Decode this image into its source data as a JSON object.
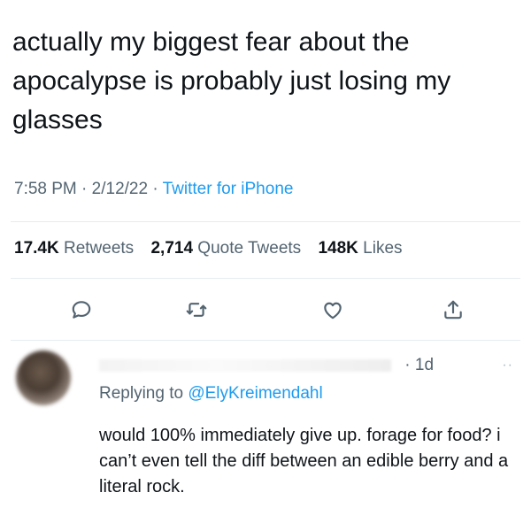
{
  "tweet": {
    "text": "actually my biggest fear about the\napocalypse is probably just losing my\nglasses",
    "time": "7:58 PM",
    "separator": "·",
    "date": "2/12/22",
    "source": "Twitter for iPhone"
  },
  "stats": {
    "retweets_count": "17.4K",
    "retweets_label": "Retweets",
    "quote_count": "2,714",
    "quote_label": "Quote Tweets",
    "likes_count": "148K",
    "likes_label": "Likes"
  },
  "actions": [
    "reply-icon",
    "retweet-icon",
    "like-icon",
    "share-icon"
  ],
  "reply": {
    "timestamp": "· 1d",
    "more": "··",
    "replying_prefix": "Replying to",
    "replying_handle": "@ElyKreimendahl",
    "text": "would 100% immediately give up. forage for food? i can’t even tell the diff between an edible berry and a literal rock."
  },
  "colors": {
    "link": "#1d9bf0",
    "secondary": "#536471",
    "primary": "#0f1419",
    "divider": "#e6ecf0"
  }
}
